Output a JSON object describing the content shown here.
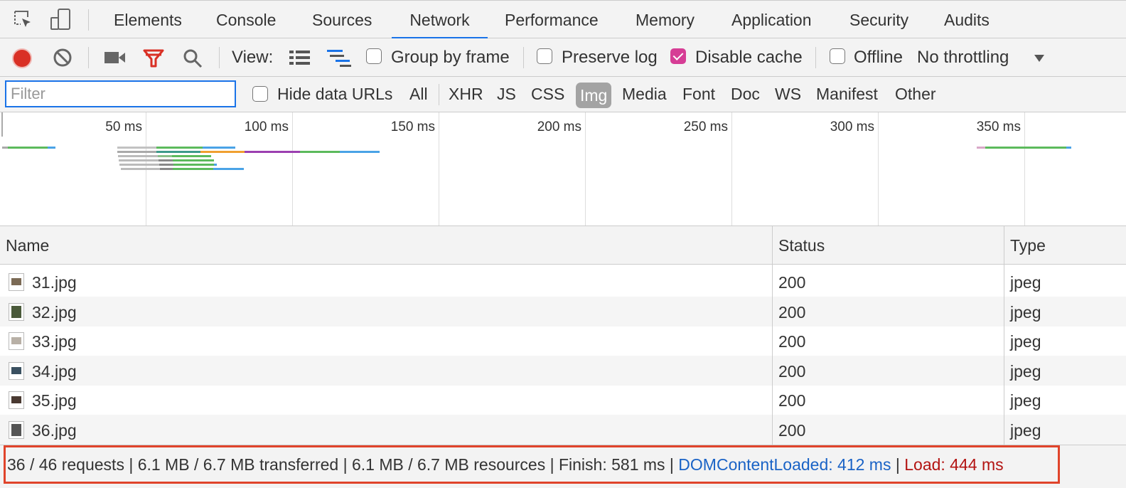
{
  "tabs": [
    {
      "label": "Elements"
    },
    {
      "label": "Console"
    },
    {
      "label": "Sources"
    },
    {
      "label": "Network",
      "active": true
    },
    {
      "label": "Performance"
    },
    {
      "label": "Memory"
    },
    {
      "label": "Application"
    },
    {
      "label": "Security"
    },
    {
      "label": "Audits"
    }
  ],
  "toolbar": {
    "view_label": "View:",
    "group_by_frame": {
      "label": "Group by frame",
      "checked": false
    },
    "preserve_log": {
      "label": "Preserve log",
      "checked": false
    },
    "disable_cache": {
      "label": "Disable cache",
      "checked": true
    },
    "offline": {
      "label": "Offline",
      "checked": false
    },
    "throttling": "No throttling"
  },
  "filter": {
    "placeholder": "Filter",
    "hide_data_urls": "Hide data URLs",
    "types": [
      "All",
      "XHR",
      "JS",
      "CSS",
      "Img",
      "Media",
      "Font",
      "Doc",
      "WS",
      "Manifest",
      "Other"
    ],
    "active_type": "Img"
  },
  "overview": {
    "ticks": [
      "50 ms",
      "100 ms",
      "150 ms",
      "200 ms",
      "250 ms",
      "300 ms",
      "350 ms"
    ]
  },
  "table": {
    "columns": [
      "Name",
      "Status",
      "Type"
    ],
    "rows": [
      {
        "name": "31.jpg",
        "status": "200",
        "type": "jpeg"
      },
      {
        "name": "32.jpg",
        "status": "200",
        "type": "jpeg"
      },
      {
        "name": "33.jpg",
        "status": "200",
        "type": "jpeg"
      },
      {
        "name": "34.jpg",
        "status": "200",
        "type": "jpeg"
      },
      {
        "name": "35.jpg",
        "status": "200",
        "type": "jpeg"
      },
      {
        "name": "36.jpg",
        "status": "200",
        "type": "jpeg"
      }
    ]
  },
  "status": {
    "summary": "36 / 46 requests | 6.1 MB / 6.7 MB transferred | 6.1 MB / 6.7 MB resources | Finish: 581 ms | ",
    "dom_content_loaded": "DOMContentLoaded: 412 ms",
    "divider": " | ",
    "load": "Load: 444 ms"
  },
  "colors": {
    "accent": "#1a73e8",
    "record": "#d93025",
    "filter_icon": "#d93025",
    "checked": "#d63d95",
    "highlight_box": "#e0442b"
  }
}
